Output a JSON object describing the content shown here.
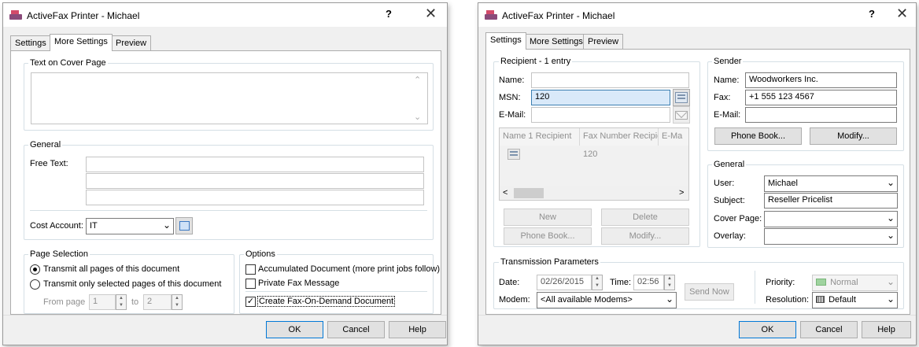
{
  "left_window": {
    "title": "ActiveFax Printer - Michael",
    "help_glyph": "?",
    "close_glyph": "✕",
    "tabs": [
      {
        "label": "Settings",
        "active": false
      },
      {
        "label": "More Settings",
        "active": true
      },
      {
        "label": "Preview",
        "active": false
      }
    ],
    "cover": {
      "title": "Text on Cover Page",
      "value": ""
    },
    "general": {
      "title": "General",
      "free_text_label": "Free Text:",
      "free_text_lines": [
        "",
        "",
        ""
      ],
      "cost_account_label": "Cost Account:",
      "cost_account_value": "IT"
    },
    "page_selection": {
      "title": "Page Selection",
      "radio_all": "Transmit all pages of this document",
      "radio_selected": "Transmit only selected pages of this document",
      "from_label": "From page",
      "from_value": "1",
      "to_label": "to",
      "to_value": "2"
    },
    "options": {
      "title": "Options",
      "accumulated": "Accumulated Document (more print jobs follow)",
      "private": "Private Fax Message",
      "fod": "Create Fax-On-Demand Document"
    },
    "footer": {
      "ok": "OK",
      "cancel": "Cancel",
      "help": "Help"
    }
  },
  "right_window": {
    "title": "ActiveFax Printer - Michael",
    "help_glyph": "?",
    "close_glyph": "✕",
    "tabs": [
      {
        "label": "Settings",
        "active": true
      },
      {
        "label": "More Settings",
        "active": false
      },
      {
        "label": "Preview",
        "active": false
      }
    ],
    "recipient": {
      "title": "Recipient - 1 entry",
      "name_label": "Name:",
      "name_value": "",
      "msn_label": "MSN:",
      "msn_value": "120",
      "email_label": "E-Mail:",
      "email_value": "",
      "columns": [
        "Name 1 Recipient",
        "Fax Number Recipien",
        "E-Ma"
      ],
      "rows": [
        {
          "name": "",
          "fax": "120",
          "email": ""
        }
      ],
      "scroll_left": "<",
      "scroll_right": ">",
      "new_button": "New",
      "delete_button": "Delete",
      "phonebook_button": "Phone Book...",
      "modify_button": "Modify..."
    },
    "sender": {
      "title": "Sender",
      "name_label": "Name:",
      "name_value": "Woodworkers Inc.",
      "fax_label": "Fax:",
      "fax_value": "+1 555 123 4567",
      "email_label": "E-Mail:",
      "email_value": "",
      "phonebook_button": "Phone Book...",
      "modify_button": "Modify..."
    },
    "general": {
      "title": "General",
      "user_label": "User:",
      "user_value": "Michael",
      "subject_label": "Subject:",
      "subject_value": "Reseller Pricelist",
      "cover_label": "Cover Page:",
      "cover_value": "",
      "overlay_label": "Overlay:",
      "overlay_value": ""
    },
    "transmission": {
      "title": "Transmission Parameters",
      "date_label": "Date:",
      "date_value": "02/26/2015",
      "time_label": "Time:",
      "time_value": "02:56",
      "modem_label": "Modem:",
      "modem_value": "<All available Modems>",
      "send_now": "Send Now",
      "priority_label": "Priority:",
      "priority_value": "Normal",
      "resolution_label": "Resolution:",
      "resolution_value": "Default"
    },
    "footer": {
      "ok": "OK",
      "cancel": "Cancel",
      "help": "Help"
    }
  }
}
